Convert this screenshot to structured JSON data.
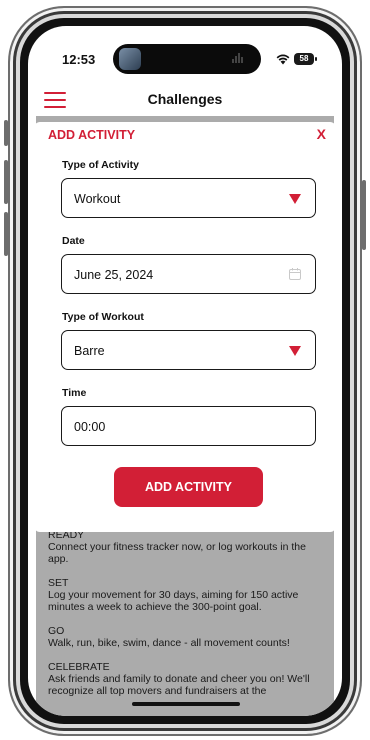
{
  "status_bar": {
    "time": "12:53",
    "battery": "58"
  },
  "header": {
    "title": "Challenges"
  },
  "modal": {
    "title": "ADD ACTIVITY",
    "close_label": "X",
    "fields": {
      "activity_type": {
        "label": "Type of Activity",
        "value": "Workout"
      },
      "date": {
        "label": "Date",
        "value": "June 25, 2024"
      },
      "workout_type": {
        "label": "Type of Workout",
        "value": "Barre"
      },
      "time": {
        "label": "Time",
        "value": "00:00"
      }
    },
    "submit_label": "ADD ACTIVITY"
  },
  "background": {
    "ready_title": "READY",
    "ready_text": "Connect your fitness tracker now, or log workouts in the app.",
    "set_title": "SET",
    "set_text": "Log your movement for 30 days, aiming for 150 active minutes a week to achieve the 300-point goal.",
    "go_title": "GO",
    "go_text": "Walk, run, bike, swim, dance - all movement counts!",
    "celebrate_title": "CELEBRATE",
    "celebrate_text": "Ask friends and family to donate and cheer you on! We'll recognize all top movers and fundraisers at the"
  },
  "colors": {
    "accent": "#d21f36",
    "overlay": "#ababab"
  }
}
